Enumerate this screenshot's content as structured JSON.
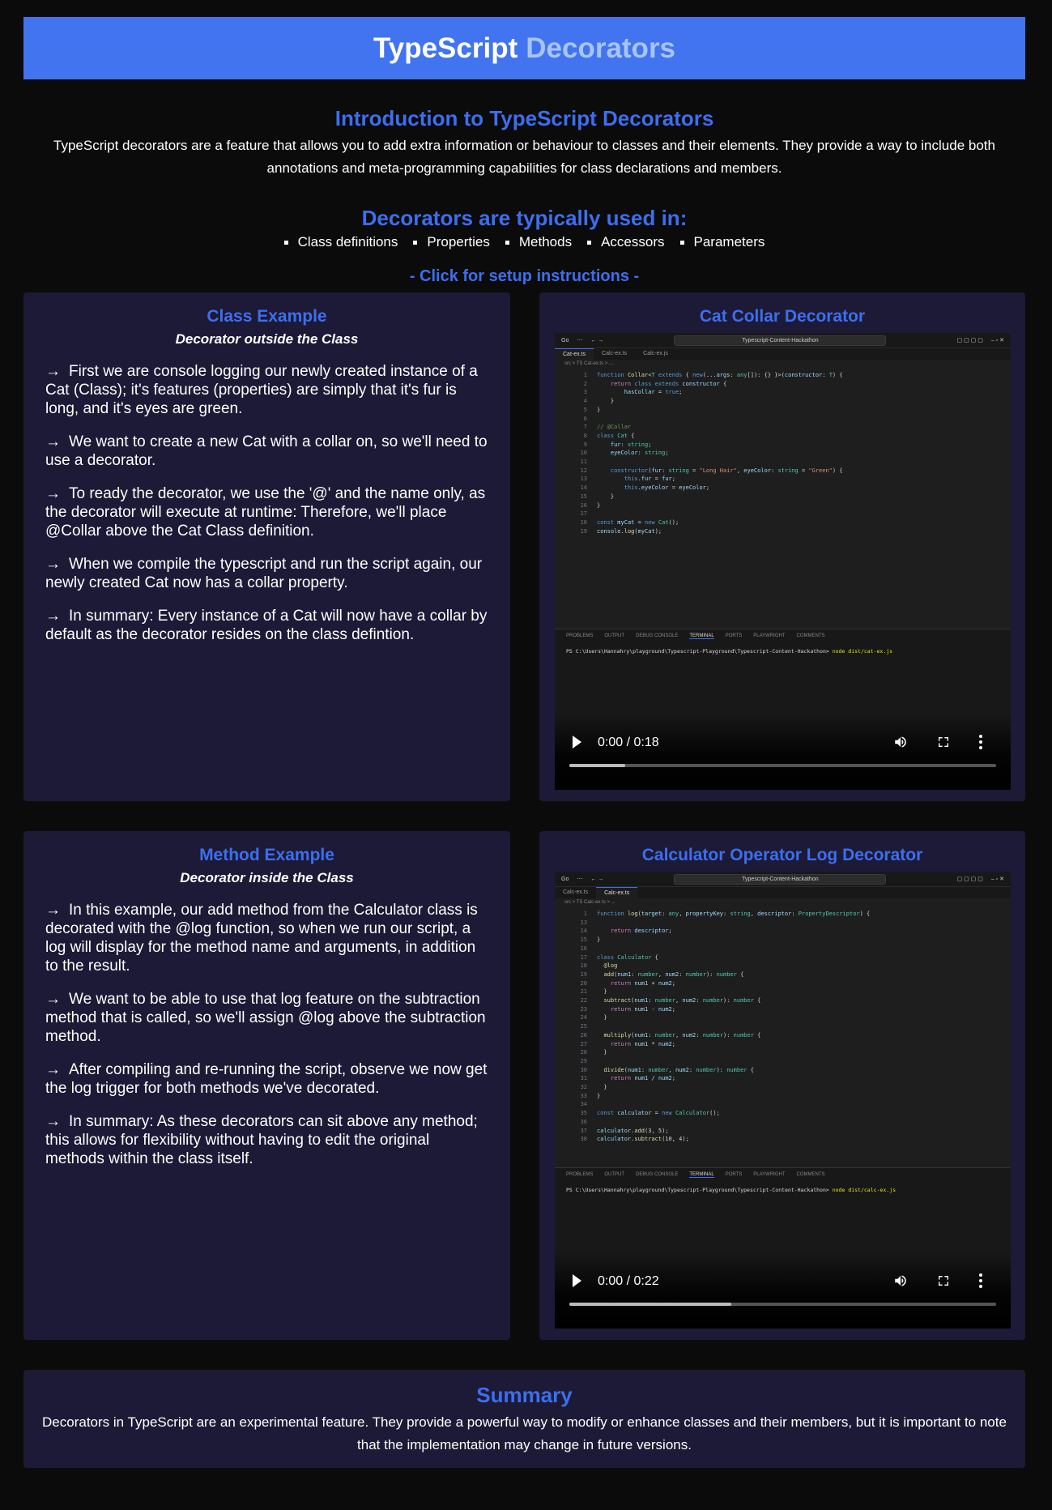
{
  "header": {
    "title_main": "TypeScript",
    "title_accent": "Decorators"
  },
  "intro": {
    "heading": "Introduction to TypeScript Decorators",
    "text": "TypeScript decorators are a feature that allows you to add extra information or behaviour to classes and their elements. They provide a way to include both annotations and meta-programming capabilities for class declarations and members."
  },
  "uses": {
    "heading": "Decorators are typically used in:",
    "items": [
      "Class definitions",
      "Properties",
      "Methods",
      "Accessors",
      "Parameters"
    ]
  },
  "setup_link": "- Click for setup instructions -",
  "class_example": {
    "title": "Class Example",
    "subtitle": "Decorator outside the Class",
    "arrow": "→",
    "paragraphs": [
      "First we are console logging our newly created instance of a Cat (Class); it's features (properties) are simply that it's fur is long, and it's eyes are green.",
      "We want to create a new Cat with a collar on, so we'll need to use a decorator.",
      "To ready the decorator, we use the '@' and the name only, as the decorator will execute at runtime: Therefore, we'll place @Collar above the Cat Class definition.",
      "When we compile the typescript and run the script again, our newly created Cat now has a collar property.",
      "In summary: Every instance of a Cat will now have a collar by default as the decorator resides on the class defintion."
    ]
  },
  "cat_video": {
    "title": "Cat Collar Decorator",
    "command_center": "Typescript-Content-Hackathon",
    "tabs": [
      "Cat-ex.ts",
      "Calc-ex.ts",
      "Calc-ex.js"
    ],
    "breadcrumb": "src > TS Cat-ex.ts > ...",
    "terminal_prompt": "PS C:\\Users\\Hannahry\\playground\\Typescript-Playground\\Typescript-Content-Hackathon>",
    "terminal_cmd": "node dist/cat-ex.js",
    "time": "0:00 / 0:18",
    "progress": 0.13
  },
  "method_example": {
    "title": "Method Example",
    "subtitle": "Decorator inside the Class",
    "arrow": "→",
    "paragraphs": [
      "In this example, our add method from the Calculator class is decorated with the @log function, so when we run our script, a log will display for the method name and arguments, in addition to the result.",
      "We want to be able to use that log feature on the subtraction method that is called, so we'll assign @log above the subtraction method.",
      "After compiling and re-running the script, observe we now get the log trigger for both methods we've decorated.",
      "In summary: As these decorators can sit above any method; this allows for flexibility without having to edit the original methods within the class itself."
    ]
  },
  "calc_video": {
    "title": "Calculator Operator Log Decorator",
    "command_center": "Typescript-Content-Hackathon",
    "tabs": [
      "Calc-ex.ts",
      "Calc-ex.ts"
    ],
    "breadcrumb": "src > TS Calc-ex.ts > ...",
    "terminal_prompt": "PS C:\\Users\\Hannahry\\playground\\Typescript-Playground\\Typescript-Content-Hackathon>",
    "terminal_cmd": "node dist/calc-ex.js",
    "time": "0:00 / 0:22",
    "progress": 0.38
  },
  "panel_tabs": [
    "PROBLEMS",
    "OUTPUT",
    "DEBUG CONSOLE",
    "TERMINAL",
    "PORTS",
    "PLAYWRIGHT",
    "COMMENTS"
  ],
  "summary": {
    "heading": "Summary",
    "text": "Decorators in TypeScript are an experimental feature. They provide a powerful way to modify or enhance classes and their members, but it is important to note that the implementation may change in future versions."
  }
}
